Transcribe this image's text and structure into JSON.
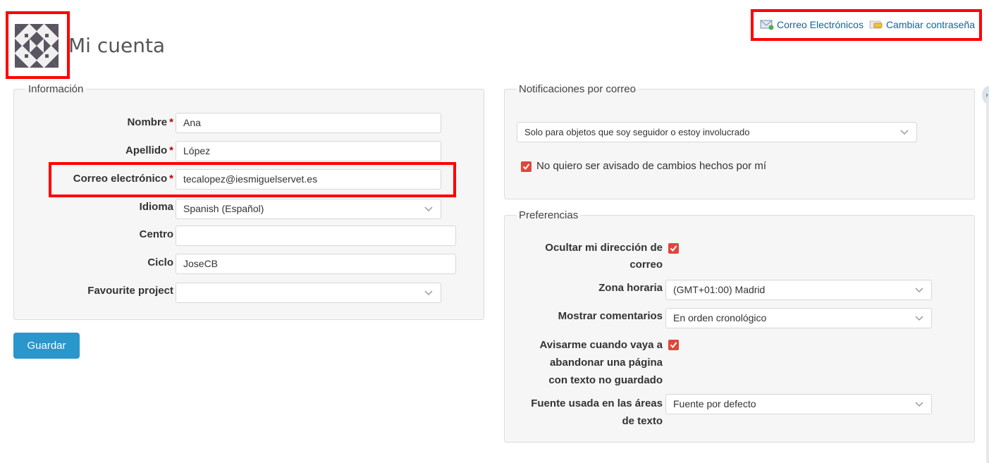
{
  "page": {
    "title": "Mi cuenta"
  },
  "top_links": {
    "emails": "Correo Electrónicos",
    "change_password": "Cambiar contraseña"
  },
  "info": {
    "legend": "Información",
    "fields": {
      "nombre": {
        "label": "Nombre",
        "value": "Ana"
      },
      "apellido": {
        "label": "Apellido",
        "value": "López"
      },
      "correo": {
        "label": "Correo electrónico",
        "value": "tecalopez@iesmiguelservet.es"
      },
      "idioma": {
        "label": "Idioma",
        "value": "Spanish (Español)"
      },
      "centro": {
        "label": "Centro",
        "value": ""
      },
      "ciclo": {
        "label": "Ciclo",
        "value": "JoseCB"
      },
      "favourite": {
        "label": "Favourite project",
        "value": ""
      }
    },
    "required_mark": "*"
  },
  "save_button": "Guardar",
  "notifications": {
    "legend": "Notificaciones por correo",
    "select_value": "Solo para objetos que soy seguidor o estoy involucrado",
    "no_self_notify": "No quiero ser avisado de cambios hechos por mí",
    "no_self_notify_checked": true
  },
  "prefs": {
    "legend": "Preferencias",
    "hide_email": {
      "label_l1": "Ocultar mi dirección de",
      "label_l2": "correo",
      "checked": true
    },
    "timezone": {
      "label": "Zona horaria",
      "value": "(GMT+01:00) Madrid"
    },
    "comments": {
      "label": "Mostrar comentarios",
      "value": "En orden cronológico"
    },
    "warn_unsaved": {
      "label_l1": "Avisarme cuando vaya a",
      "label_l2": "abandonar una página",
      "label_l3": "con texto no guardado",
      "checked": true
    },
    "font": {
      "label_l1": "Fuente usada en las áreas",
      "label_l2": "de texto",
      "value": "Fuente por defecto"
    }
  },
  "colors": {
    "link": "#116699",
    "accent_button": "#2996cc",
    "checkbox": "#e0473c",
    "highlight": "#ff0000",
    "required": "#bb0000"
  }
}
